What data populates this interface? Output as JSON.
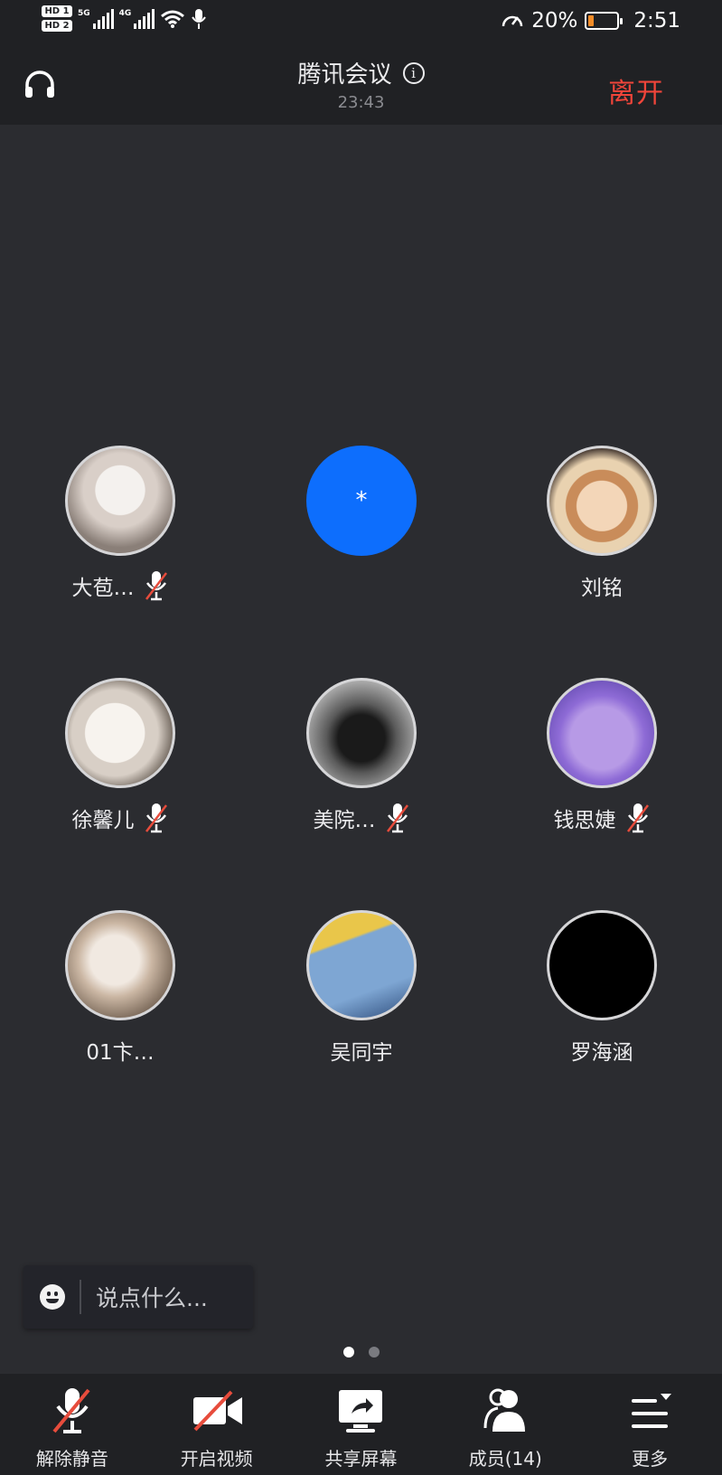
{
  "status_bar": {
    "hd1": "HD 1",
    "hd2": "HD 2",
    "net1": "5G",
    "net2": "4G",
    "battery_percent_text": "20%",
    "battery_level": 0.2,
    "time": "2:51"
  },
  "header": {
    "title": "腾讯会议",
    "timer": "23:43",
    "leave_label": "离开"
  },
  "participants": [
    {
      "name": "大苞…",
      "muted": true,
      "avatar": "bunny-plush-photo"
    },
    {
      "name": "",
      "muted": false,
      "avatar": "blue-default",
      "initial": "*"
    },
    {
      "name": "刘铭",
      "muted": false,
      "avatar": "doll-photo"
    },
    {
      "name": "徐馨儿",
      "muted": true,
      "avatar": "puppy-photo"
    },
    {
      "name": "美院…",
      "muted": true,
      "avatar": "dark-butterfly-photo"
    },
    {
      "name": "钱思婕",
      "muted": true,
      "avatar": "purple-cartoon-photo"
    },
    {
      "name": "01卞…",
      "muted": false,
      "avatar": "kitten-photo"
    },
    {
      "name": "吴同宇",
      "muted": false,
      "avatar": "blue-storefront-photo"
    },
    {
      "name": "罗海涵",
      "muted": false,
      "avatar": "black"
    }
  ],
  "chat": {
    "placeholder": "说点什么..."
  },
  "pagination": {
    "pages": 2,
    "current": 1
  },
  "toolbar": {
    "unmute_label": "解除静音",
    "video_label": "开启视频",
    "share_label": "共享屏幕",
    "members_label": "成员(14)",
    "more_label": "更多"
  },
  "colors": {
    "background": "#2b2c30",
    "bar": "#202124",
    "leave": "#f0453a",
    "accent_blue": "#0d6efd",
    "mute_slash": "#e74c3c"
  }
}
